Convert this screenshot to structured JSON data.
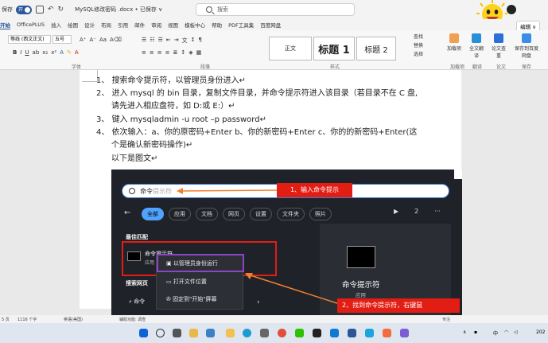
{
  "titlebar": {
    "save_label": "保存",
    "autosave_label": "开",
    "doc_title": "MySQL修改密码 .docx • 已保存 ∨",
    "search_placeholder": "搜索"
  },
  "tabs": [
    {
      "label": "开始",
      "active": true
    },
    {
      "label": "OfficePLUS"
    },
    {
      "label": "插入"
    },
    {
      "label": "绘图"
    },
    {
      "label": "设计"
    },
    {
      "label": "布局"
    },
    {
      "label": "引用"
    },
    {
      "label": "邮件"
    },
    {
      "label": "审阅"
    },
    {
      "label": "视图"
    },
    {
      "label": "模板中心"
    },
    {
      "label": "帮助"
    },
    {
      "label": "PDF工具集"
    },
    {
      "label": "百度网盘"
    }
  ],
  "edit_button": "编辑 ∨",
  "ribbon": {
    "font_name": "等线 (西文正文)",
    "font_size": "五号",
    "group_font": "字体",
    "group_paragraph": "段落",
    "group_styles": "样式",
    "style_normal": "正文",
    "style_h1": "标题 1",
    "style_h2": "标题 2",
    "find": "查找",
    "replace": "替换",
    "select": "选择",
    "btn_load": "加载项",
    "btn_translate": "全文翻译",
    "btn_paper": "论文查重",
    "btn_baidu": "保存到百度网盘",
    "group_load": "加载项",
    "group_translate": "翻译",
    "group_paper": "论文",
    "group_save": "保存"
  },
  "document": {
    "lines": [
      "1、 搜索命令提示符，以管理员身份进入↵",
      "2、 进入 mysql 的 bin 目录，复制文件目录，并命令提示符进入该目录（若目录不在 C 盘,",
      "请先进入相应盘符，如 D:或 E:）↵",
      "3、 键入 mysqladmin -u root –p password↵",
      "4、 依次输入：a、你的原密码+Enter    b、你的新密码+Enter    c、你的的新密码+Enter(这",
      "个是确认新密码操作)↵",
      "以下是图文↵"
    ]
  },
  "screenshot": {
    "search_typed": "命令",
    "search_hint": "提示符",
    "callout1": "1、输入命令提示",
    "filters": [
      "全部",
      "应用",
      "文档",
      "网页",
      "设置",
      "文件夹",
      "照片"
    ],
    "play_icon": "▶",
    "count": "2",
    "more": "···",
    "best_match": "最佳匹配",
    "result_name": "命令提示符",
    "result_sub": "应用",
    "web_search": "搜索网页",
    "web_item": "命令",
    "ctx_run_admin": "以管理员身份运行",
    "ctx_open_location": "打开文件位置",
    "ctx_pin_start": "固定到\"开始\"屏幕",
    "preview_name": "命令提示符",
    "preview_sub": "应用",
    "callout2": "2、找到命令提示符，右键鼠"
  },
  "statusbar": {
    "pages": "5 页",
    "words": "1116 个字",
    "lang": "英语(美国)",
    "accessibility": "辅助功能: 调查",
    "focus": "专注"
  },
  "taskbar": {
    "time": "202"
  }
}
